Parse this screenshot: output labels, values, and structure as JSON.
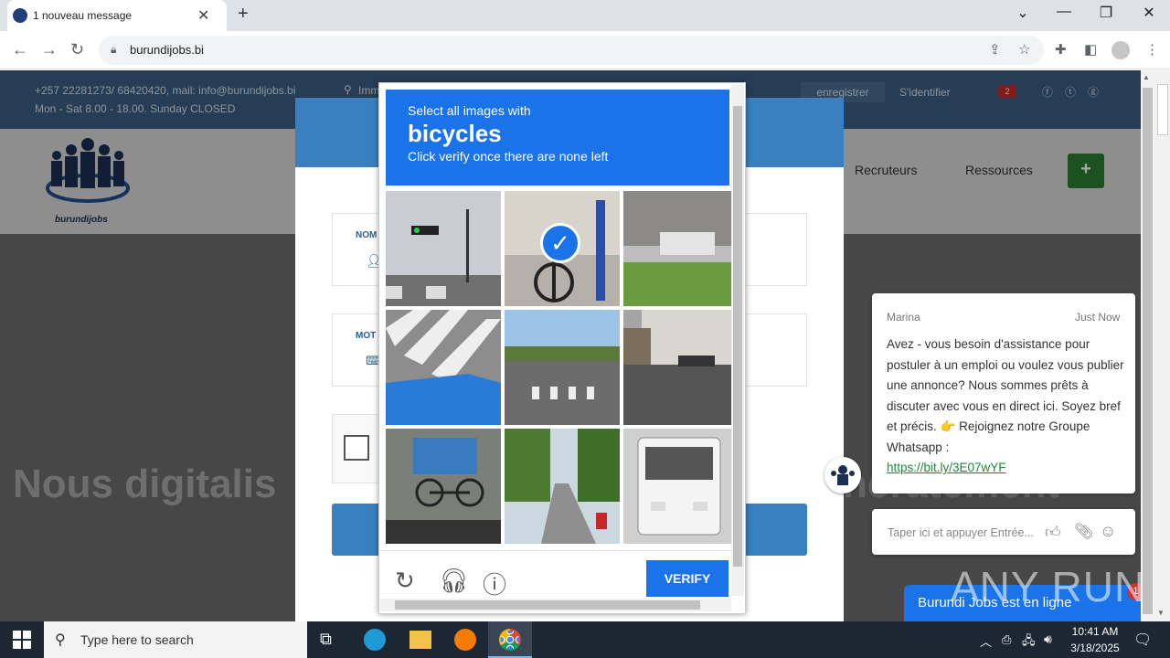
{
  "browser": {
    "tab_title": "1 nouveau message",
    "url": "burundijobs.bi"
  },
  "site": {
    "contact_line": "+257 22281273/ 68420420, mail: info@burundijobs.bi",
    "address_fragment": "Imm",
    "hours": "Mon - Sat 8.00 - 18.00. Sunday CLOSED",
    "register": "enregistrer",
    "login": "S'identifier",
    "notif_count": "2",
    "logo_text": "burundijobs",
    "nav": [
      "Recruteurs",
      "Ressources"
    ],
    "add_icon": "+",
    "hero_text": "Nous digitalis",
    "hero_right": "ncratement",
    "field_name_label": "NOM",
    "field_pass_label": "MOT"
  },
  "captcha": {
    "line1": "Select all images with",
    "keyword": "bicycles",
    "line3": "Click verify once there are none left",
    "verify": "VERIFY",
    "tiles": [
      {
        "name": "traffic-light-street",
        "selected": false
      },
      {
        "name": "bicycle-against-wall",
        "selected": true
      },
      {
        "name": "storefront-grass",
        "selected": false
      },
      {
        "name": "crosswalk-blue-roof",
        "selected": false
      },
      {
        "name": "crosswalk-road",
        "selected": false
      },
      {
        "name": "street-corner-building",
        "selected": false
      },
      {
        "name": "bicycle-parked",
        "selected": false
      },
      {
        "name": "road-motorbike-trees",
        "selected": false
      },
      {
        "name": "white-bus",
        "selected": false
      }
    ]
  },
  "chat": {
    "agent": "Marina",
    "time": "Just Now",
    "message": "Avez - vous besoin d'assistance pour postuler à un emploi ou voulez vous publier une annonce? Nous sommes prêts à discuter avec vous en direct ici. Soyez bref et précis. 👉 Rejoignez notre Groupe Whatsapp :",
    "link": "https://bit.ly/3E07wYF",
    "input_placeholder": "Taper ici et appuyer Entrée...",
    "online_label": "Burundi Jobs est en ligne",
    "badge": "1"
  },
  "watermark": "ANY RUN",
  "taskbar": {
    "search_placeholder": "Type here to search",
    "time": "10:41 AM",
    "date": "3/18/2025"
  },
  "colors": {
    "captcha_blue": "#1a73e8",
    "site_blue": "#3c5f83"
  }
}
